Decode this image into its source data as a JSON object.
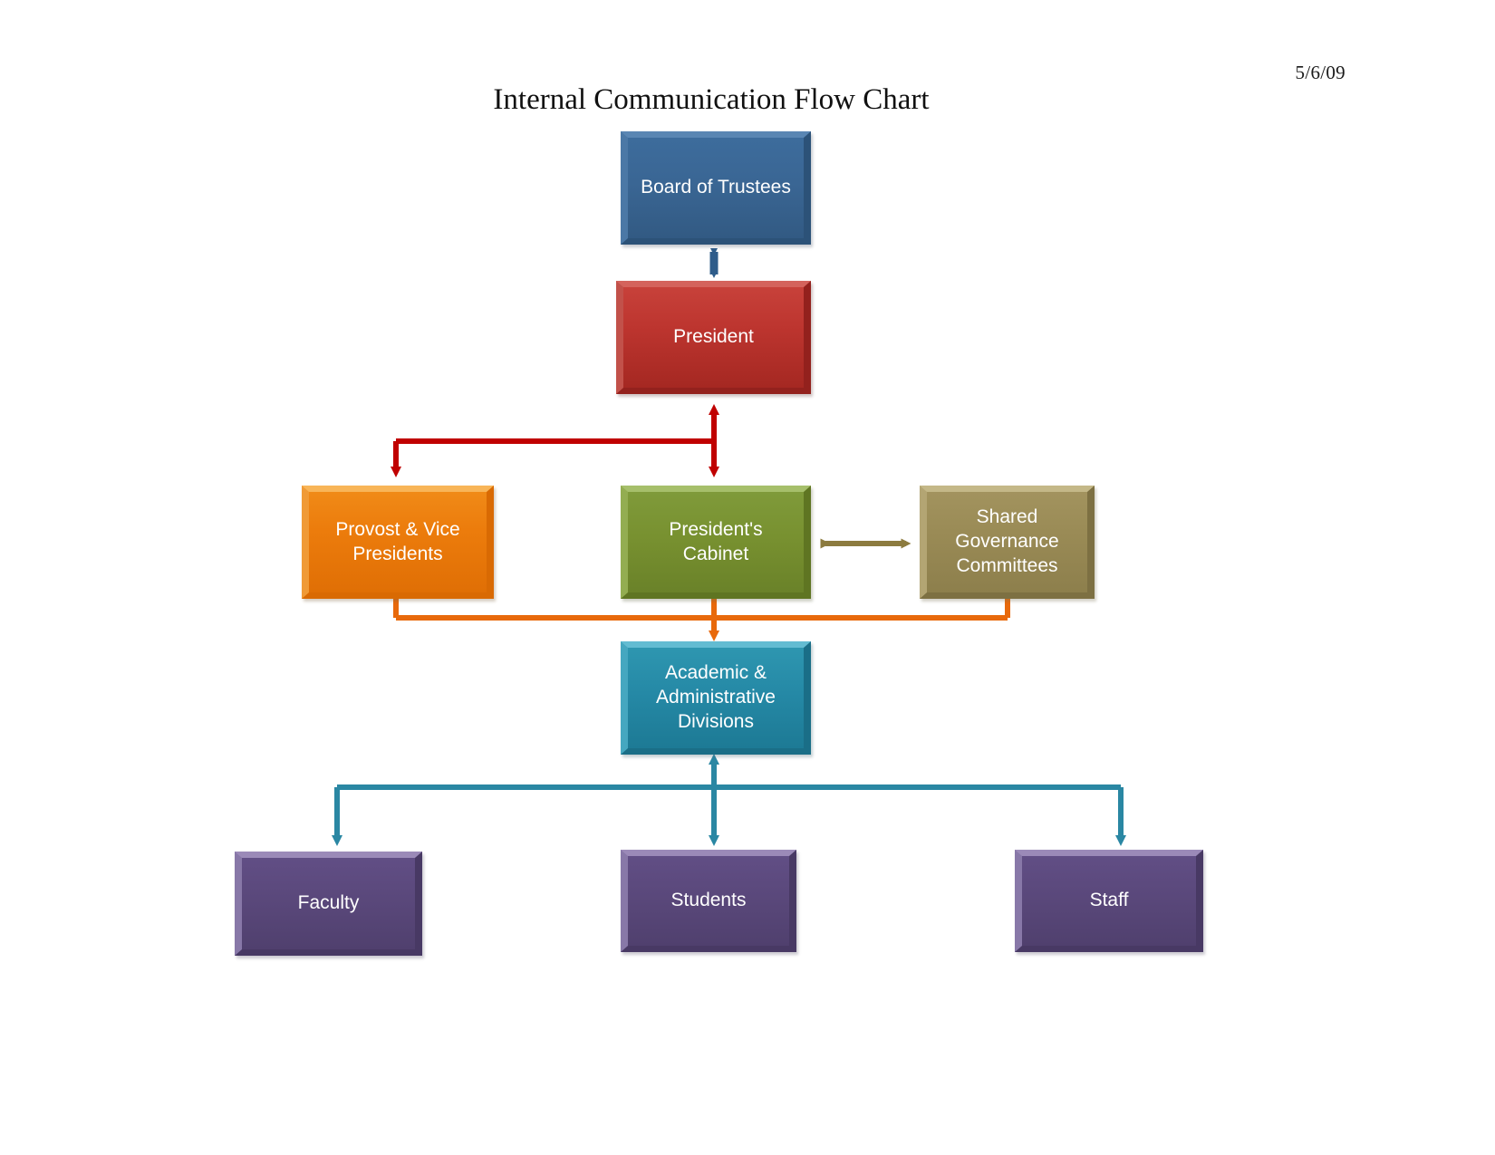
{
  "document": {
    "date": "5/6/09",
    "title": "Internal Communication Flow Chart"
  },
  "chart_data": {
    "type": "diagram",
    "diagram_kind": "organizational-flow-chart",
    "title": "Internal Communication Flow Chart",
    "date": "5/6/09",
    "nodes": [
      {
        "id": "board",
        "label": "Board of Trustees",
        "color": "#35628f",
        "level": 1
      },
      {
        "id": "president",
        "label": "President",
        "color": "#b5302c",
        "level": 2
      },
      {
        "id": "provost",
        "label": "Provost & Vice\nPresidents",
        "color": "#ed7d10",
        "level": 3
      },
      {
        "id": "cabinet",
        "label": "President's\nCabinet",
        "color": "#76902f",
        "level": 3
      },
      {
        "id": "shared",
        "label": "Shared\nGovernance\nCommittees",
        "color": "#9a8b55",
        "level": 3
      },
      {
        "id": "divisions",
        "label": "Academic &\nAdministrative\nDivisions",
        "color": "#2589a6",
        "level": 4
      },
      {
        "id": "faculty",
        "label": "Faculty",
        "color": "#5c4a7e",
        "level": 5
      },
      {
        "id": "students",
        "label": "Students",
        "color": "#5c4a7e",
        "level": 5
      },
      {
        "id": "staff",
        "label": "Staff",
        "color": "#5c4a7e",
        "level": 5
      }
    ],
    "edges": [
      {
        "from": "board",
        "to": "president",
        "direction": "both",
        "color": "#2e5c8a"
      },
      {
        "from": "president",
        "to": "provost",
        "direction": "to",
        "color": "#c00000"
      },
      {
        "from": "president",
        "to": "cabinet",
        "direction": "both",
        "color": "#c00000"
      },
      {
        "from": "cabinet",
        "to": "shared",
        "direction": "both",
        "color": "#8c7b3f"
      },
      {
        "from": "divisions",
        "to": "provost",
        "direction": "to",
        "color": "#e8690b"
      },
      {
        "from": "divisions",
        "to": "cabinet",
        "direction": "both",
        "color": "#e8690b"
      },
      {
        "from": "divisions",
        "to": "shared",
        "direction": "to",
        "color": "#e8690b"
      },
      {
        "from": "faculty",
        "to": "divisions",
        "direction": "to",
        "color": "#2a87a3"
      },
      {
        "from": "students",
        "to": "divisions",
        "direction": "to",
        "color": "#2a87a3"
      },
      {
        "from": "staff",
        "to": "divisions",
        "direction": "to",
        "color": "#2a87a3"
      }
    ],
    "palette": {
      "board": "#35628f",
      "president": "#b5302c",
      "provost": "#ed7d10",
      "cabinet": "#76902f",
      "shared": "#9a8b55",
      "divisions": "#2589a6",
      "people": "#5c4a7e",
      "background": "#ffffff"
    }
  },
  "nodes": {
    "board": {
      "label": "Board of Trustees"
    },
    "president": {
      "label": "President"
    },
    "provost": {
      "label": "Provost & Vice\nPresidents"
    },
    "cabinet": {
      "label": "President's\nCabinet"
    },
    "shared": {
      "label": "Shared\nGovernance\nCommittees"
    },
    "divisions": {
      "label": "Academic &\nAdministrative\nDivisions"
    },
    "faculty": {
      "label": "Faculty"
    },
    "students": {
      "label": "Students"
    },
    "staff": {
      "label": "Staff"
    }
  }
}
